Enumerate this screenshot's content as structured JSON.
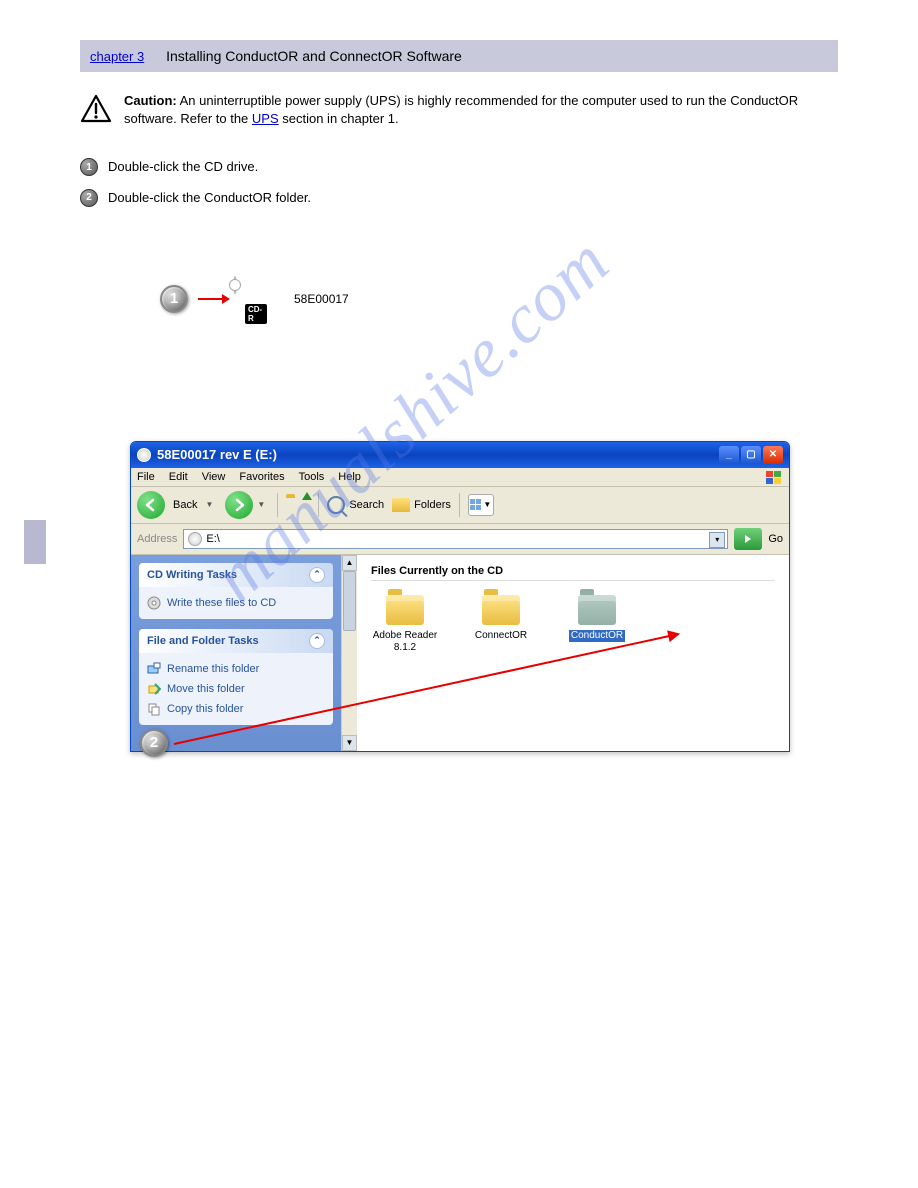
{
  "header": {
    "link_text": "chapter 3",
    "title": "Installing ConductOR and ConnectOR Software"
  },
  "caution": {
    "bold": "Caution:",
    "pre": " An uninterruptible power supply (UPS) is highly recommended for the computer used to run the ConductOR software. Refer to the ",
    "link": "UPS",
    "post": " section in chapter 1."
  },
  "steps": {
    "s1": "Double-click the CD drive.",
    "s2": "Double-click the ConductOR folder."
  },
  "fig1": {
    "cd_tag": "CD-R",
    "label": "58E00017"
  },
  "window": {
    "title": "58E00017 rev E (E:)",
    "menu": {
      "file": "File",
      "edit": "Edit",
      "view": "View",
      "fav": "Favorites",
      "tools": "Tools",
      "help": "Help"
    },
    "toolbar": {
      "back": "Back",
      "search": "Search",
      "folders": "Folders"
    },
    "address": {
      "label": "Address",
      "value": "E:\\",
      "go": "Go"
    },
    "sidebar": {
      "panel1": {
        "title": "CD Writing Tasks",
        "task1": "Write these files to CD"
      },
      "panel2": {
        "title": "File and Folder Tasks",
        "task1": "Rename this folder",
        "task2": "Move this folder",
        "task3": "Copy this folder"
      }
    },
    "content": {
      "heading": "Files Currently on the CD",
      "items": {
        "adobe": "Adobe Reader 8.1.2",
        "connector": "ConnectOR",
        "conductor": "ConductOR"
      }
    }
  },
  "watermark": "manualshive.com"
}
